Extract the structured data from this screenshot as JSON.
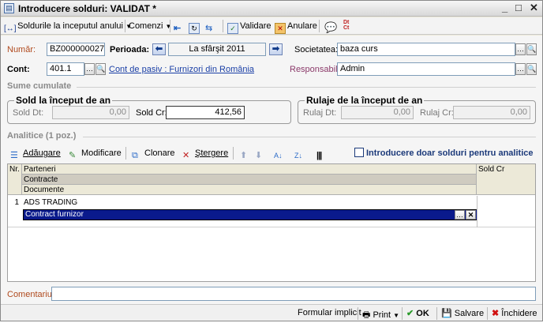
{
  "window": {
    "title": "Introducere solduri: VALIDAT *",
    "controls": [
      "_",
      "□",
      "✕"
    ]
  },
  "toolbar": {
    "opening_balances": "Soldurile la inceputul anului",
    "commands": "Comenzi",
    "validate": "Validare",
    "cancel": "Anulare",
    "dtct_icon": "Dt Ct"
  },
  "header": {
    "number_label": "Număr:",
    "number_value": "BZ000000027",
    "period_label": "Perioada:",
    "period_value": "La sfârşit 2011",
    "company_label": "Societatea:",
    "company_value": "baza curs",
    "account_label": "Cont:",
    "account_value": "401.1",
    "account_link": "Cont de pasiv : Furnizori din România",
    "responsible_label": "Responsabil:",
    "responsible_value": "Admin"
  },
  "cumulative": {
    "section_title": "Sume cumulate",
    "opening": {
      "title": "Sold la început de an",
      "dt_label": "Sold Dt:",
      "dt_value": "0,00",
      "cr_label": "Sold Cr:",
      "cr_value": "412,56"
    },
    "turnover": {
      "title": "Rulaje de la început de an",
      "dt_label": "Rulaj Dt:",
      "dt_value": "0,00",
      "cr_label": "Rulaj Cr:",
      "cr_value": "0,00"
    }
  },
  "analytics": {
    "section_title": "Analitice (1 poz.)",
    "add": "Adăugare",
    "modify": "Modificare",
    "clone": "Clonare",
    "delete": "Ştergere",
    "only_balances": "Introducere doar solduri pentru analitice",
    "columns": {
      "nr": "Nr.",
      "partners": "Parteneri",
      "contracts": "Contracte",
      "documents": "Documente",
      "credit": "Sold Cr"
    },
    "rows": [
      {
        "nr": "1",
        "partner": "ADS TRADING",
        "contract": "Contract furnizor"
      }
    ]
  },
  "comment_label": "Comentariu:",
  "statusbar": {
    "default_form": "Formular implicit",
    "print": "Print",
    "ok": "OK",
    "save": "Salvare",
    "close": "Închidere"
  },
  "colors": {
    "selection": "#0a1a8c",
    "link": "#1a3fa6",
    "label_red": "#b04a1e"
  }
}
